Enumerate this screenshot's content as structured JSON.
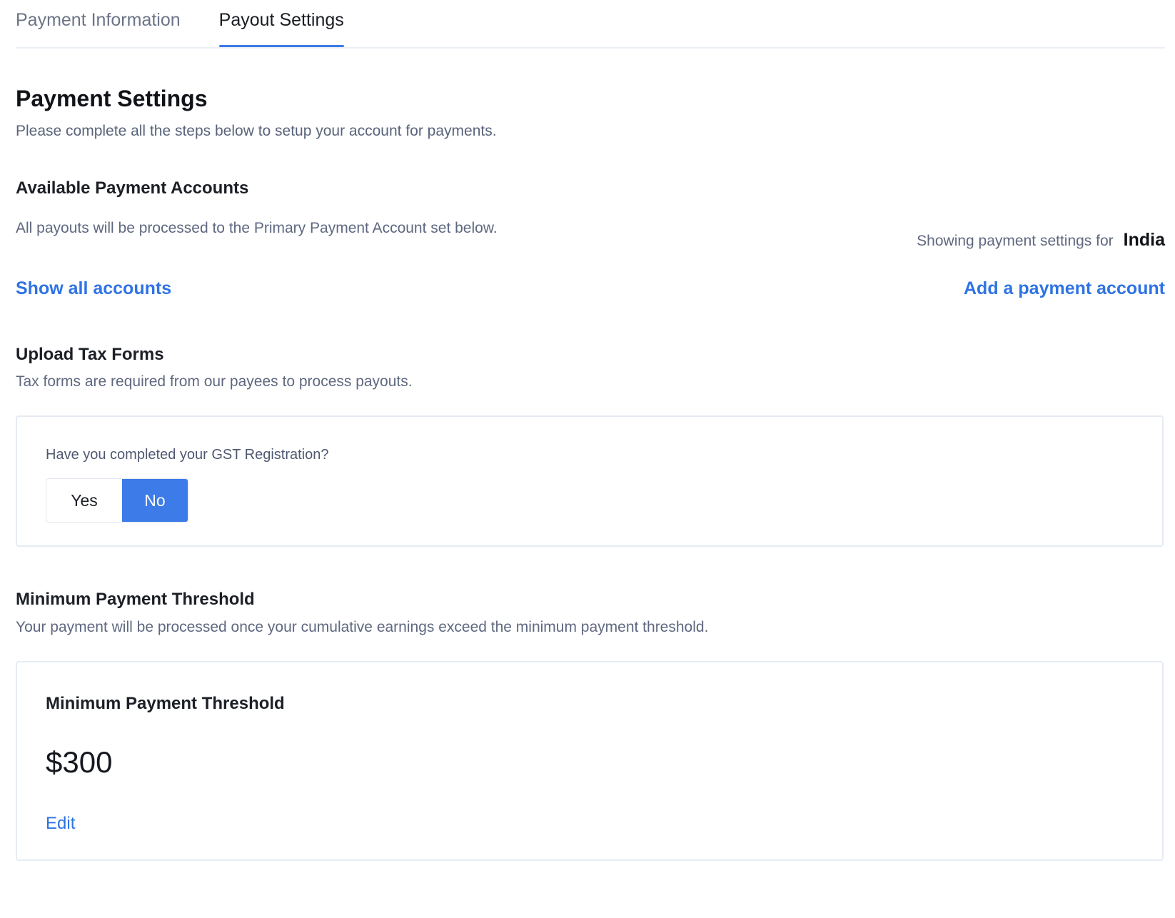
{
  "tabs": [
    {
      "label": "Payment Information",
      "active": false
    },
    {
      "label": "Payout Settings",
      "active": true
    }
  ],
  "header": {
    "title": "Payment Settings",
    "subtitle": "Please complete all the steps below to setup your account for payments."
  },
  "payment_accounts": {
    "heading": "Available Payment Accounts",
    "description": "All payouts will be processed to the Primary Payment Account set below.",
    "showing_label": "Showing payment settings for",
    "country": "India",
    "show_all_label": "Show all accounts",
    "add_account_label": "Add a payment account"
  },
  "tax_forms": {
    "heading": "Upload Tax Forms",
    "description": "Tax forms are required from our payees to process payouts.",
    "question": "Have you completed your GST Registration?",
    "options": [
      "Yes",
      "No"
    ],
    "selected": "No"
  },
  "threshold": {
    "heading": "Minimum Payment Threshold",
    "description": "Your payment will be processed once your cumulative earnings exceed the minimum payment threshold.",
    "card_title": "Minimum Payment Threshold",
    "amount": "$300",
    "edit_label": "Edit"
  },
  "colors": {
    "accent": "#3d7be8",
    "link": "#2f73e4",
    "muted_text": "#5f6880",
    "border": "#e6ebf3"
  }
}
